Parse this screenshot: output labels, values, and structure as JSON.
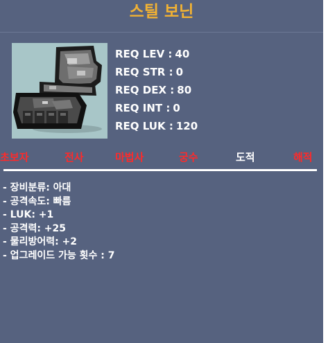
{
  "item": {
    "name": "스틸 보닌",
    "icon": "steel-gauntlet-icon"
  },
  "requirements": [
    {
      "label": "REQ LEV :",
      "value": "40"
    },
    {
      "label": "REQ STR :",
      "value": "0"
    },
    {
      "label": "REQ DEX :",
      "value": "80"
    },
    {
      "label": "REQ INT :",
      "value": "0"
    },
    {
      "label": "REQ LUK :",
      "value": "120"
    }
  ],
  "jobs": [
    {
      "name": "초보자",
      "allowed": false
    },
    {
      "name": "전사",
      "allowed": false
    },
    {
      "name": "마법사",
      "allowed": false
    },
    {
      "name": "궁수",
      "allowed": false
    },
    {
      "name": "도적",
      "allowed": true
    },
    {
      "name": "해적",
      "allowed": false
    }
  ],
  "stats": [
    "- 장비분류: 아대",
    "- 공격속도: 빠름",
    "- LUK: +1",
    "- 공격력: +25",
    "- 물리방어력: +2",
    "- 업그레이드 가능 횟수 : 7"
  ],
  "colors": {
    "background": "#56627f",
    "title": "#f2b233",
    "job_disallowed": "#ff2a2a",
    "job_allowed": "#ffffff",
    "text": "#ffffff"
  }
}
